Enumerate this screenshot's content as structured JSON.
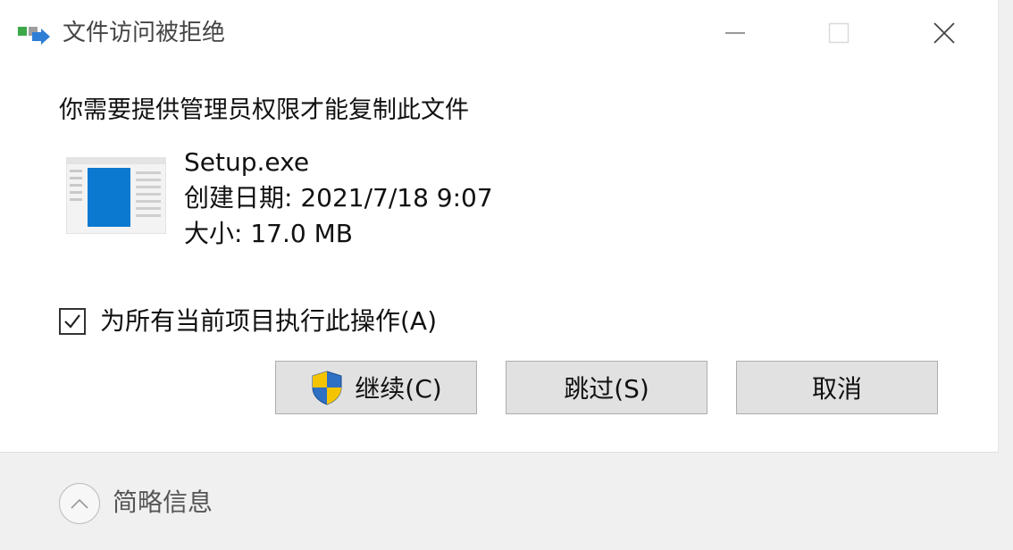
{
  "window": {
    "title": "文件访问被拒绝",
    "controls": {
      "minimize_icon": "minimize-icon",
      "maximize_icon": "maximize-icon",
      "close_icon": "close-icon"
    }
  },
  "dialog": {
    "message": "你需要提供管理员权限才能复制此文件",
    "file": {
      "name": "Setup.exe",
      "created_label": "创建日期: 2021/7/18 9:07",
      "size_label": "大小: 17.0 MB",
      "icon": "file-thumbnail-icon"
    },
    "apply_all": {
      "label": "为所有当前项目执行此操作(A)",
      "checked": true
    },
    "buttons": {
      "continue_label": "继续(C)",
      "skip_label": "跳过(S)",
      "cancel_label": "取消"
    }
  },
  "footer": {
    "toggle_label": "简略信息",
    "toggle_icon": "chevron-up-icon"
  },
  "colors": {
    "button_bg": "#e1e1e1",
    "button_border": "#adadad",
    "footer_bg": "#f0f0f0",
    "accent_blue": "#0078d7"
  }
}
